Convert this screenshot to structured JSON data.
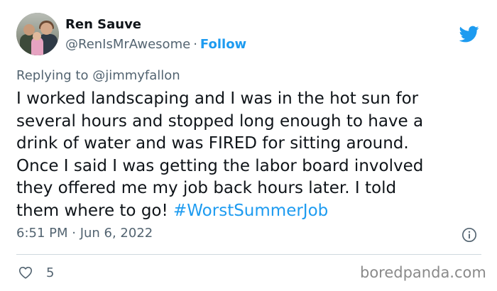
{
  "author": {
    "name": "Ren Sauve",
    "handle": "@RenIsMrAwesome",
    "separator": "·",
    "follow_label": "Follow"
  },
  "reply": {
    "text": "Replying to @jimmyfallon"
  },
  "tweet": {
    "lines": [
      "I worked landscaping and I was in the hot sun for",
      "several hours and stopped long enough to have a",
      "drink of water and was FIRED for sitting around.",
      "Once I said I was getting the labor board involved",
      "they offered me my job back hours later. I told",
      "them where to go! "
    ],
    "hashtag": "#WorstSummerJob"
  },
  "meta": {
    "timestamp": "6:51 PM · Jun 6, 2022"
  },
  "actions": {
    "like_count": "5"
  },
  "watermark": {
    "text": "boredpanda.com"
  },
  "icons": {
    "brand": "twitter-bird-icon",
    "info": "info-icon",
    "like": "heart-icon"
  },
  "colors": {
    "accent": "#1d9bf0",
    "text": "#0f1419",
    "secondary": "#536471",
    "divider": "#cfd9de"
  }
}
